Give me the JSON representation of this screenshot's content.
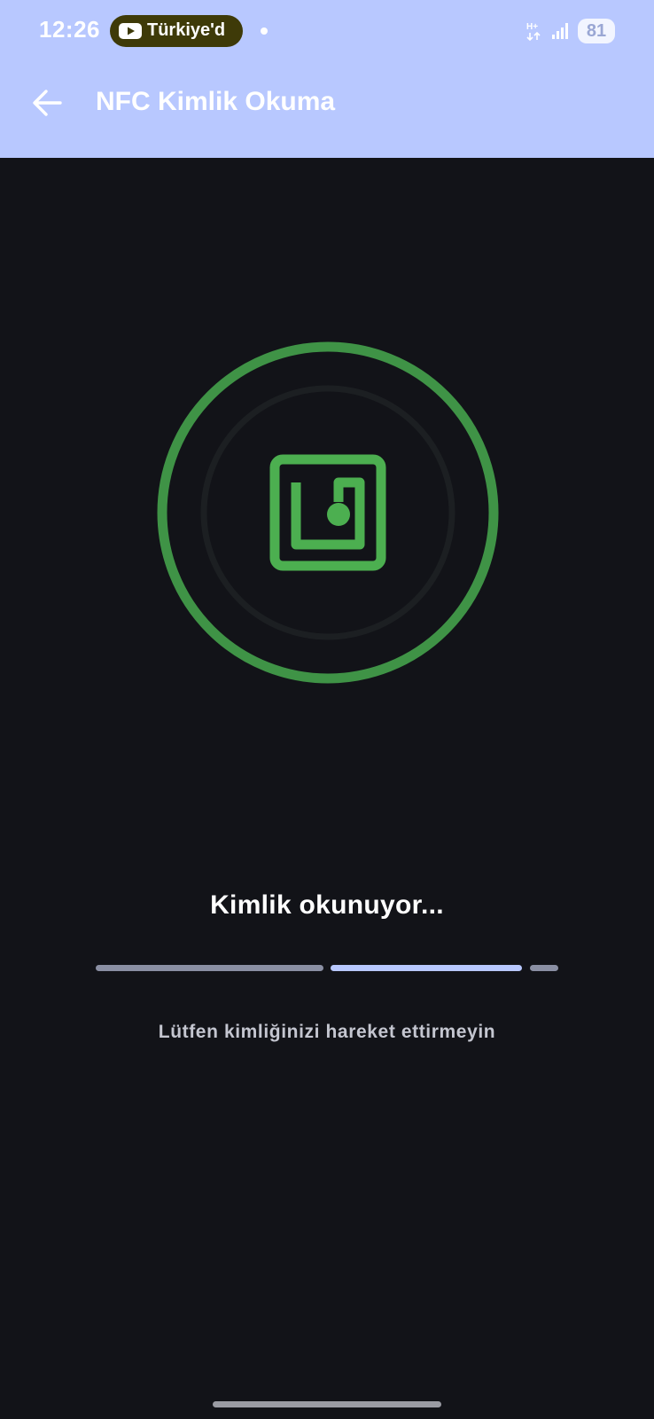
{
  "status_bar": {
    "time": "12:26",
    "notification_text": "Türkiye'd",
    "network_label": "H+",
    "battery": "81"
  },
  "header": {
    "title": "NFC Kimlik Okuma",
    "back_icon": "arrow-back-icon"
  },
  "nfc": {
    "icon": "nfc-icon",
    "ring_color": "#3f9346",
    "icon_color": "#4caf50"
  },
  "status": {
    "message": "Kimlik okunuyor...",
    "hint": "Lütfen kimliğinizi hareket ettirmeyin"
  },
  "colors": {
    "header_bg": "#b8c8ff",
    "page_bg": "#121318",
    "active_segment": "#b8c8ff",
    "inactive_segment": "#8a8fa3"
  }
}
